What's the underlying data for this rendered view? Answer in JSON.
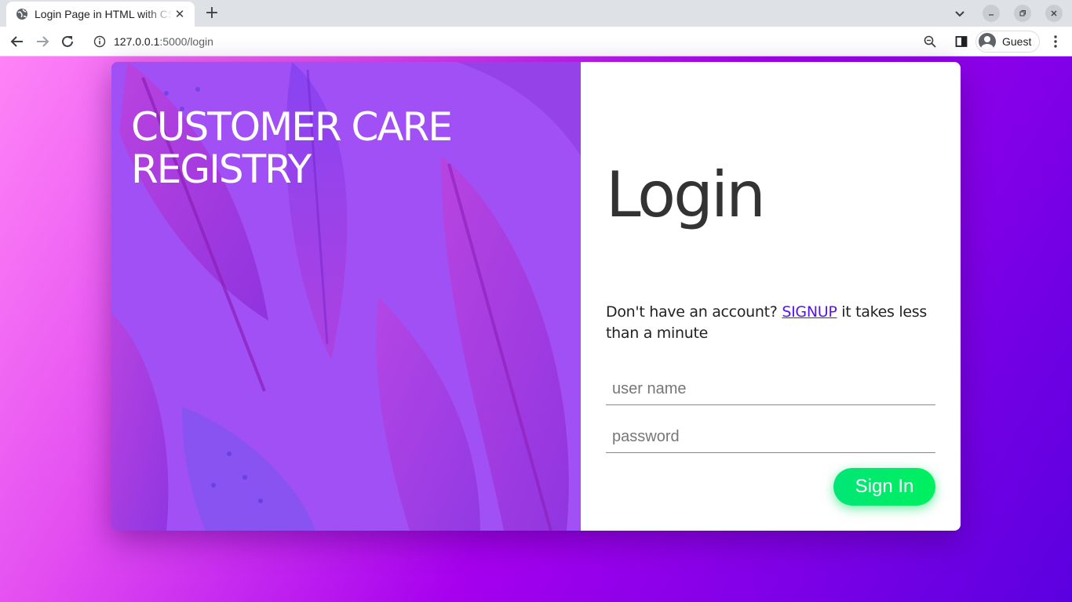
{
  "browser": {
    "tab_title": "Login Page in HTML with CSS",
    "url_host": "127.0.0.1",
    "url_path": ":5000/login",
    "profile_name": "Guest"
  },
  "brand": {
    "title": "CUSTOMER CARE REGISTRY"
  },
  "login": {
    "heading": "Login",
    "signup_prompt": "Don't have an account?",
    "signup_link": "SIGNUP",
    "signup_suffix": "it takes less than a minute",
    "username_placeholder": "user name",
    "password_placeholder": "password",
    "signin_label": "Sign In"
  },
  "colors": {
    "accent_link": "#5a14e6",
    "signin_button": "#00e676",
    "panel_purple": "#a050f5",
    "background_gradient_start": "#ff84f7",
    "background_gradient_end": "#5a00e0"
  },
  "icons": [
    "globe-icon",
    "close-icon",
    "plus-icon",
    "chevron-down-icon",
    "minimize-icon",
    "restore-icon",
    "back-icon",
    "forward-icon",
    "reload-icon",
    "info-icon",
    "zoom-icon",
    "side-panel-icon",
    "avatar-icon",
    "more-menu-icon"
  ]
}
